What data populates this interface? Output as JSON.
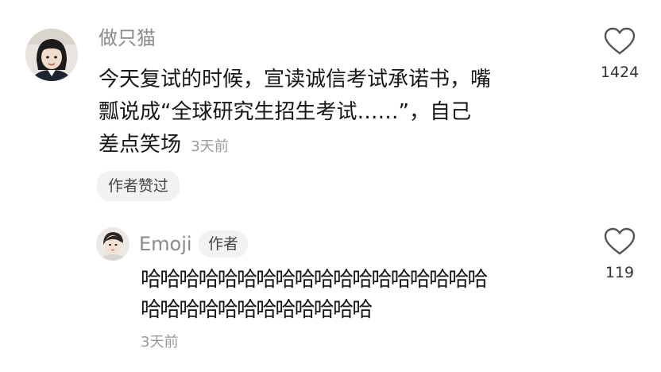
{
  "comment": {
    "username": "做只猫",
    "text_lines": [
      "今天复试的时候，宣读诚信考试承诺书，嘴",
      "瓢说成“全球研究生招生考试……”，自己",
      "差点笑场"
    ],
    "time": "3天前",
    "like_count": "1424",
    "author_liked_label": "作者赞过"
  },
  "reply": {
    "username": "Emoji",
    "author_badge": "作者",
    "text_lines": [
      "哈哈哈哈哈哈哈哈哈哈哈哈哈哈哈哈哈哈",
      "哈哈哈哈哈哈哈哈哈哈哈哈"
    ],
    "time": "3天前",
    "like_count": "119"
  },
  "icons": {
    "like": "heart-outline-icon"
  },
  "colors": {
    "username": "#8b8b8b",
    "text": "#161616",
    "time": "#9a9a9a",
    "pill_bg": "#f2f2f2"
  }
}
